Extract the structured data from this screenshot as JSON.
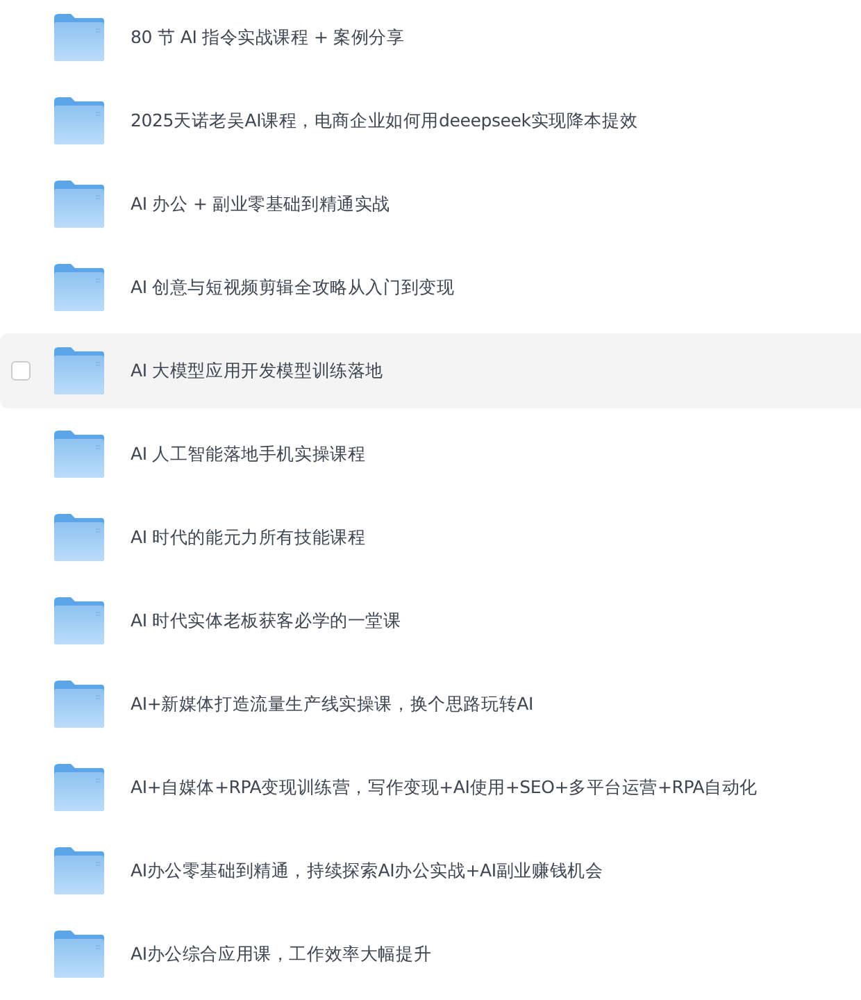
{
  "folders": [
    {
      "name": "80 节 AI 指令实战课程 + 案例分享",
      "hovered": false
    },
    {
      "name": "2025天诺老吴AI课程，电商企业如何用deeepseek实现降本提效",
      "hovered": false
    },
    {
      "name": "AI 办公 + 副业零基础到精通实战",
      "hovered": false
    },
    {
      "name": "AI 创意与短视频剪辑全攻略从入门到变现",
      "hovered": false
    },
    {
      "name": "AI 大模型应用开发模型训练落地",
      "hovered": true,
      "checked": false
    },
    {
      "name": "AI 人工智能落地手机实操课程",
      "hovered": false
    },
    {
      "name": "AI 时代的能元力所有技能课程",
      "hovered": false
    },
    {
      "name": "AI 时代实体老板获客必学的一堂课",
      "hovered": false
    },
    {
      "name": "AI+新媒体打造流量生产线实操课，换个思路玩转AI",
      "hovered": false
    },
    {
      "name": "AI+自媒体+RPA变现训练营，写作变现+AI使用+SEO+多平台运营+RPA自动化",
      "hovered": false
    },
    {
      "name": "AI办公零基础到精通，持续探索AI办公实战+AI副业赚钱机会",
      "hovered": false
    },
    {
      "name": "AI办公综合应用课，工作效率大幅提升",
      "hovered": false
    }
  ]
}
